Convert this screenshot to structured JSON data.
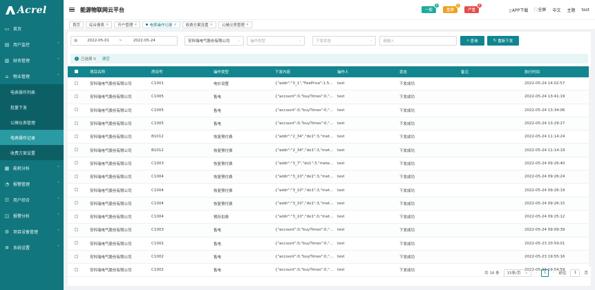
{
  "brand": {
    "logo_text": "Acrel"
  },
  "header": {
    "title": "能源物联网云平台",
    "alerts": [
      {
        "label": "一般",
        "count": "0",
        "color": "#1fa99a"
      },
      {
        "label": "重要",
        "count": "0",
        "color": "#f0a020"
      },
      {
        "label": "严重",
        "count": "0",
        "color": "#e64a4a"
      }
    ],
    "app_download": "APP下载",
    "fullscreen": "全屏",
    "language": "中文",
    "theme": "主题",
    "user": "test"
  },
  "sidebar": {
    "items": [
      {
        "label": "首页",
        "icon": "monitor-icon"
      },
      {
        "label": "用户监控",
        "icon": "user-monitor-icon"
      },
      {
        "label": "财务管理",
        "icon": "finance-icon"
      },
      {
        "label": "物业管理",
        "icon": "property-icon",
        "expanded": true
      },
      {
        "label": "能耗分析",
        "icon": "chart-icon"
      },
      {
        "label": "报警管理",
        "icon": "alarm-icon"
      },
      {
        "label": "用户综合",
        "icon": "users-icon"
      },
      {
        "label": "报警分析",
        "icon": "analysis-icon"
      },
      {
        "label": "项目设备管理",
        "icon": "device-icon"
      },
      {
        "label": "系统设置",
        "icon": "gear-icon"
      }
    ],
    "submenu": [
      {
        "label": "电表操作列表"
      },
      {
        "label": "批量下发"
      },
      {
        "label": "公摊仪表管理"
      },
      {
        "label": "电表操作记录",
        "active": true
      },
      {
        "label": "收费方案设置"
      }
    ]
  },
  "tabs": [
    {
      "label": "首页"
    },
    {
      "label": "综合报表"
    },
    {
      "label": "开户管理"
    },
    {
      "label": "电表操作记录",
      "active": true
    },
    {
      "label": "收费方案设置"
    },
    {
      "label": "公摊仪表管理"
    }
  ],
  "filters": {
    "date_start": "2022-05-01",
    "date_sep": "~",
    "date_end": "2022-05-24",
    "company": "安科瑞电气股份有限公司",
    "op_type_placeholder": "操作类型",
    "status_placeholder": "下发状态",
    "meter_placeholder": "请输入",
    "search_label": "查询",
    "refresh_label": "重新下发"
  },
  "selection": {
    "text": "已选择 0",
    "clear": "清空"
  },
  "table": {
    "columns": [
      "项目名称",
      "房间号",
      "操作类型",
      "下发内容",
      "操作人",
      "状态",
      "备注",
      "执行时间"
    ],
    "rows": [
      [
        "安科瑞电气股份有限公司",
        "C1001",
        "电价设置",
        "{\"addr\":\"3_1\",\"FeePrice\":1.5...",
        "test",
        "下发成功",
        "",
        "2022-05-24 14:02:57"
      ],
      [
        "安科瑞电气股份有限公司",
        "C1005",
        "售电",
        "{\"account\":0,\"buyTimes\":0,\"...",
        "test",
        "下发成功",
        "",
        "2022-05-24 13:41:19"
      ],
      [
        "安科瑞电气股份有限公司",
        "C1005",
        "售电",
        "{\"account\":0,\"buyTimes\":0,\"...",
        "test",
        "下发成功",
        "",
        "2022-05-24 13:34:06"
      ],
      [
        "安科瑞电气股份有限公司",
        "C1005",
        "售电",
        "{\"account\":0,\"buyTimes\":0,\"...",
        "test",
        "下发成功",
        "",
        "2022-05-24 13:29:27"
      ],
      [
        "安科瑞电气股份有限公司",
        "B1012",
        "恢复预付费",
        "{\"addr\":\"2_34\",\"do1\":3,\"met...",
        "test",
        "下发成功",
        "",
        "2022-05-24 11:14:24"
      ],
      [
        "安科瑞电气股份有限公司",
        "B1012",
        "恢复预付费",
        "{\"addr\":\"2_34\",\"do1\":3,\"met...",
        "test",
        "下发成功",
        "",
        "2022-05-24 11:14:19"
      ],
      [
        "安科瑞电气股份有限公司",
        "C1003",
        "恢复预付费",
        "{\"addr\":\"3_7\",\"do1\":3,\"mete...",
        "test",
        "下发成功",
        "",
        "2022-05-24 09:26:40"
      ],
      [
        "安科瑞电气股份有限公司",
        "C1004",
        "恢复预付费",
        "{\"addr\":\"3_10\",\"do1\":3,\"met...",
        "test",
        "下发成功",
        "",
        "2022-05-24 09:26:24"
      ],
      [
        "安科瑞电气股份有限公司",
        "C1004",
        "恢复预付费",
        "{\"addr\":\"3_10\",\"do1\":3,\"met...",
        "test",
        "下发成功",
        "",
        "2022-05-24 09:26:19"
      ],
      [
        "安科瑞电气股份有限公司",
        "C1004",
        "恢复预付费",
        "{\"addr\":\"3_10\",\"do1\":3,\"met...",
        "test",
        "下发成功",
        "",
        "2022-05-24 09:26:15"
      ],
      [
        "安科瑞电气股份有限公司",
        "C1004",
        "预存扣费",
        "{\"addr\":\"3_10\",\"do1\":0,\"met...",
        "test",
        "下发成功",
        "",
        "2022-05-24 09:25:12"
      ],
      [
        "安科瑞电气股份有限公司",
        "C1003",
        "售电",
        "{\"account\":0,\"buyTimes\":0,\"...",
        "test",
        "下发成功",
        "",
        "2022-05-24 09:09:39"
      ],
      [
        "安科瑞电气股份有限公司",
        "C1002",
        "售电",
        "{\"account\":0,\"buyTimes\":0,\"...",
        "test",
        "下发成功",
        "",
        "2022-05-23 20:59:01"
      ],
      [
        "安科瑞电气股份有限公司",
        "C1002",
        "售电",
        "{\"account\":0,\"buyTimes\":0,\"...",
        "test",
        "下发成功",
        "",
        "2022-05-23 19:55:16"
      ],
      [
        "安科瑞电气股份有限公司",
        "C1002",
        "售电",
        "{\"account\":0,\"buyTimes\":0,\"...",
        "test",
        "下发成功",
        "",
        "2022-05-23 19:54:59"
      ]
    ]
  },
  "pagination": {
    "total": "共 16 条",
    "page_size": "15条/页",
    "current": "1",
    "goto_label": "前往",
    "goto_value": "1",
    "page_suffix": "页"
  }
}
